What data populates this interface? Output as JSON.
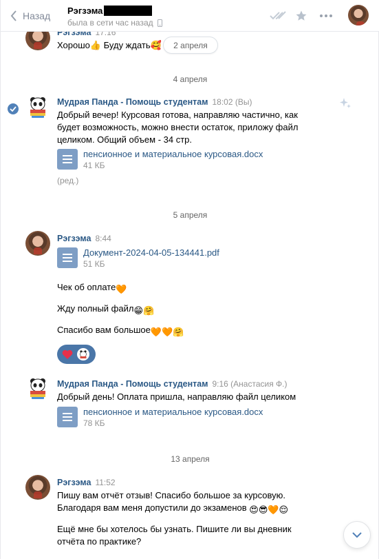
{
  "header": {
    "back_label": "Назад",
    "peer_name": "Рэгзэма",
    "peer_status": "была в сети час назад"
  },
  "date_pill": "2 апреля",
  "messages": [
    {
      "author": "Рэгзэма",
      "time": "17:16",
      "text": "Хорошо👍 Буду ждать🥰"
    },
    {
      "date": "4 апреля",
      "author": "Мудрая Панда - Помощь студентам",
      "time": "18:02 (Вы)",
      "lines": [
        "Добрый вечер! Курсовая готова, направляю частично, как",
        "будет возможность, можно внести остаток, приложу файл",
        "целиком. Общий объем - 34 стр."
      ],
      "doc": {
        "name": "пенсионное и материальное курсовая.docx",
        "size": "41 КБ"
      },
      "edited": "(ред.)"
    },
    {
      "date": "5 апреля",
      "author": "Рэгзэма",
      "time": "8:44",
      "doc": {
        "name": "Документ-2024-04-05-134441.pdf",
        "size": "51 КБ"
      },
      "texts": [
        "Чек об оплате",
        "Жду полный файл",
        "Спасибо вам большое"
      ]
    },
    {
      "author": "Мудрая Панда - Помощь студентам",
      "time": "9:16 (Анастасия Ф.)",
      "text": "Добрый день! Оплата пришла, направляю файл целиком",
      "doc": {
        "name": "пенсионное и материальное курсовая.docx",
        "size": "78 КБ"
      }
    },
    {
      "date": "13 апреля",
      "author": "Рэгзэма",
      "time": "11:52",
      "lines": [
        "Пишу вам отчёт отзыв! Спасибо большое за курсовую.",
        "Благодаря вам меня допустили до экзаменов"
      ],
      "lines2": [
        "Ещё мне бы хотелось бы узнать. Пишите ли вы дневник",
        "отчёта по практике?"
      ]
    }
  ],
  "colors": {
    "link": "#2a5885",
    "muted": "#939393",
    "accent": "#5181b8",
    "doc_icon": "#7e9ec5"
  }
}
